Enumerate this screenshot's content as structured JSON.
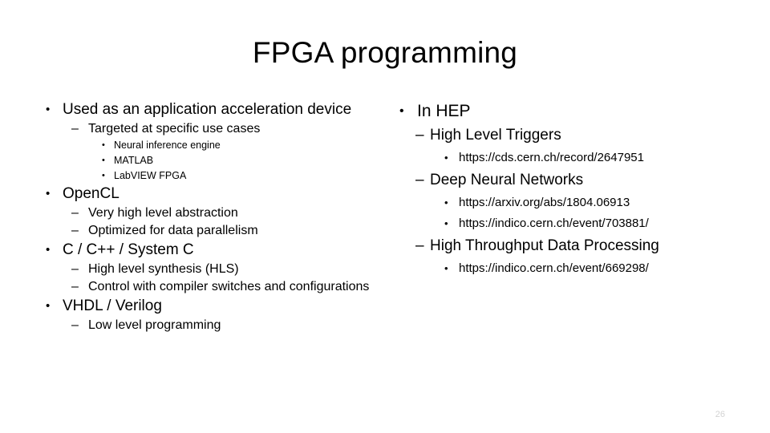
{
  "slide": {
    "title": "FPGA programming",
    "page_number": "26",
    "background_color": "#ffffff",
    "text_color": "#000000",
    "page_number_color": "#d3d3d3"
  },
  "bullets": {
    "round": "•",
    "dash": "–"
  },
  "left_column": {
    "items": [
      {
        "level": 1,
        "text": "Used as an application acceleration device"
      },
      {
        "level": 2,
        "text": "Targeted at specific use cases"
      },
      {
        "level": 3,
        "text": "Neural inference engine"
      },
      {
        "level": 3,
        "text": "MATLAB"
      },
      {
        "level": 3,
        "text": "LabVIEW FPGA"
      },
      {
        "level": 1,
        "text": "OpenCL"
      },
      {
        "level": 2,
        "text": "Very high level abstraction"
      },
      {
        "level": 2,
        "text": "Optimized for data parallelism"
      },
      {
        "level": 1,
        "text": "C / C++ / System C"
      },
      {
        "level": 2,
        "text": "High level synthesis (HLS)"
      },
      {
        "level": 2,
        "text": "Control with compiler switches and configurations"
      },
      {
        "level": 1,
        "text": "VHDL / Verilog"
      },
      {
        "level": 2,
        "text": "Low level programming"
      }
    ]
  },
  "right_column": {
    "items": [
      {
        "level": 1,
        "text": "In HEP"
      },
      {
        "level": 2,
        "text": "High Level Triggers"
      },
      {
        "level": 3,
        "text": "https://cds.cern.ch/record/2647951"
      },
      {
        "level": 2,
        "text": "Deep Neural Networks"
      },
      {
        "level": 3,
        "text": "https://arxiv.org/abs/1804.06913"
      },
      {
        "level": 3,
        "text": "https://indico.cern.ch/event/703881/"
      },
      {
        "level": 2,
        "text": "High Throughput Data Processing"
      },
      {
        "level": 3,
        "text": "https://indico.cern.ch/event/669298/"
      }
    ]
  }
}
